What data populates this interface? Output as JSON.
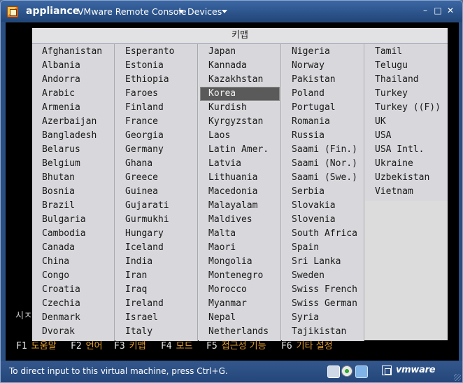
{
  "titlebar": {
    "app_name": "appliance",
    "console_label": "VMware Remote Console",
    "devices_label": "Devices",
    "minimize": "–",
    "maximize": "□",
    "close": "✕"
  },
  "dialog": {
    "title": "키맵",
    "selected": "Korea",
    "columns": [
      [
        "Afghanistan",
        "Albania",
        "Andorra",
        "Arabic",
        "Armenia",
        "Azerbaijan",
        "Bangladesh",
        "Belarus",
        "Belgium",
        "Bhutan",
        "Bosnia",
        "Brazil",
        "Bulgaria",
        "Cambodia",
        "Canada",
        "China",
        "Congo",
        "Croatia",
        "Czechia",
        "Denmark",
        "Dvorak"
      ],
      [
        "Esperanto",
        "Estonia",
        "Ethiopia",
        "Faroes",
        "Finland",
        "France",
        "Georgia",
        "Germany",
        "Ghana",
        "Greece",
        "Guinea",
        "Gujarati",
        "Gurmukhi",
        "Hungary",
        "Iceland",
        "India",
        "Iran",
        "Iraq",
        "Ireland",
        "Israel",
        "Italy"
      ],
      [
        "Japan",
        "Kannada",
        "Kazakhstan",
        "Korea",
        "Kurdish",
        "Kyrgyzstan",
        "Laos",
        "Latin Amer.",
        "Latvia",
        "Lithuania",
        "Macedonia",
        "Malayalam",
        "Maldives",
        "Malta",
        "Maori",
        "Mongolia",
        "Montenegro",
        "Morocco",
        "Myanmar",
        "Nepal",
        "Netherlands"
      ],
      [
        "Nigeria",
        "Norway",
        "Pakistan",
        "Poland",
        "Portugal",
        "Romania",
        "Russia",
        "Saami (Fin.)",
        "Saami (Nor.)",
        "Saami (Swe.)",
        "Serbia",
        "Slovakia",
        "Slovenia",
        "South Africa",
        "Spain",
        "Sri Lanka",
        "Sweden",
        "Swiss French",
        "Swiss German",
        "Syria",
        "Tajikistan"
      ],
      [
        "Tamil",
        "Telugu",
        "Thailand",
        "Turkey",
        "Turkey ((F))",
        "UK",
        "USA",
        "USA Intl.",
        "Ukraine",
        "Uzbekistan",
        "Vietnam"
      ]
    ]
  },
  "console": {
    "partial_text": "시ㅈ",
    "fkeys": [
      {
        "key": "F1",
        "label": "도움말"
      },
      {
        "key": "F2",
        "label": "언어"
      },
      {
        "key": "F3",
        "label": "키맵"
      },
      {
        "key": "F4",
        "label": "모드"
      },
      {
        "key": "F5",
        "label": "접근성 기능"
      },
      {
        "key": "F6",
        "label": "기타 설정"
      }
    ]
  },
  "statusbar": {
    "message": "To direct input to this virtual machine, press Ctrl+G.",
    "brand": "vmware"
  },
  "icons": {
    "app": "appliance-icon",
    "status": [
      "hard-disk-icon",
      "cd-rom-icon",
      "network-icon"
    ]
  },
  "colors": {
    "frame": "#2b4f82",
    "dialog_bg": "#d8d8dc",
    "selection_bg": "#5a5a5a",
    "fkey_label": "#e8a030"
  }
}
